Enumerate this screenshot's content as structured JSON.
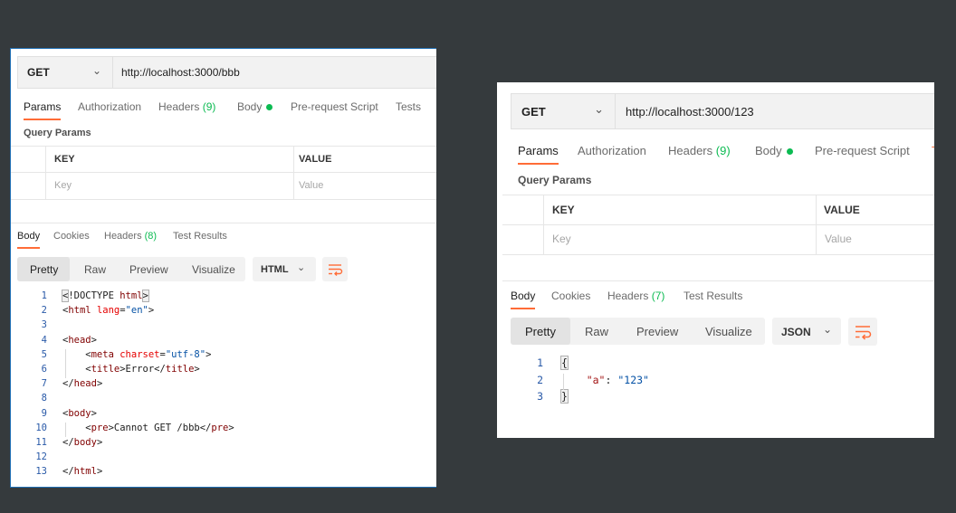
{
  "left_panel": {
    "method": "GET",
    "url": "http://localhost:3000/bbb",
    "request_tabs": [
      "Params",
      "Authorization",
      "Headers",
      "(9)",
      "Body",
      "Pre-request Script",
      "Tests"
    ],
    "query_params_label": "Query Params",
    "table": {
      "key_header": "KEY",
      "value_header": "VALUE",
      "key_placeholder": "Key",
      "value_placeholder": "Value"
    },
    "response_tabs": [
      "Body",
      "Cookies",
      "Headers",
      "(8)",
      "Test Results"
    ],
    "view_modes": [
      "Pretty",
      "Raw",
      "Preview",
      "Visualize"
    ],
    "format": "HTML",
    "code_lines": [
      {
        "n": "1",
        "parts": [
          [
            "bracket",
            "<"
          ],
          [
            "",
            "!DOCTYPE "
          ],
          [
            "tag",
            "html"
          ],
          [
            "bracket",
            ">"
          ]
        ]
      },
      {
        "n": "2",
        "parts": [
          [
            "",
            "<"
          ],
          [
            "tag",
            "html"
          ],
          [
            "attr",
            " lang"
          ],
          [
            "",
            "="
          ],
          [
            "str",
            "\"en\""
          ],
          [
            "",
            ">"
          ]
        ]
      },
      {
        "n": "3",
        "parts": []
      },
      {
        "n": "4",
        "parts": [
          [
            "",
            "<"
          ],
          [
            "tag",
            "head"
          ],
          [
            "",
            ">"
          ]
        ]
      },
      {
        "n": "5",
        "parts": [
          [
            "",
            "    <"
          ],
          [
            "tag",
            "meta"
          ],
          [
            "attr",
            " charset"
          ],
          [
            "",
            "="
          ],
          [
            "str",
            "\"utf-8\""
          ],
          [
            "",
            ">"
          ]
        ]
      },
      {
        "n": "6",
        "parts": [
          [
            "",
            "    <"
          ],
          [
            "tag",
            "title"
          ],
          [
            "",
            ">Error</"
          ],
          [
            "tag",
            "title"
          ],
          [
            "",
            ">"
          ]
        ]
      },
      {
        "n": "7",
        "parts": [
          [
            "",
            "</"
          ],
          [
            "tag",
            "head"
          ],
          [
            "",
            ">"
          ]
        ]
      },
      {
        "n": "8",
        "parts": []
      },
      {
        "n": "9",
        "parts": [
          [
            "",
            "<"
          ],
          [
            "tag",
            "body"
          ],
          [
            "",
            ">"
          ]
        ]
      },
      {
        "n": "10",
        "parts": [
          [
            "",
            "    <"
          ],
          [
            "tag",
            "pre"
          ],
          [
            "",
            ">Cannot GET /bbb</"
          ],
          [
            "tag",
            "pre"
          ],
          [
            "",
            ">"
          ]
        ]
      },
      {
        "n": "11",
        "parts": [
          [
            "",
            "</"
          ],
          [
            "tag",
            "body"
          ],
          [
            "",
            ">"
          ]
        ]
      },
      {
        "n": "12",
        "parts": []
      },
      {
        "n": "13",
        "parts": [
          [
            "",
            "</"
          ],
          [
            "tag",
            "html"
          ],
          [
            "",
            ">"
          ]
        ]
      }
    ]
  },
  "right_panel": {
    "method": "GET",
    "url": "http://localhost:3000/123",
    "request_tabs": [
      "Params",
      "Authorization",
      "Headers",
      "(9)",
      "Body",
      "Pre-request Script"
    ],
    "query_params_label": "Query Params",
    "table": {
      "key_header": "KEY",
      "value_header": "VALUE",
      "key_placeholder": "Key",
      "value_placeholder": "Value"
    },
    "response_tabs": [
      "Body",
      "Cookies",
      "Headers",
      "(7)",
      "Test Results"
    ],
    "view_modes": [
      "Pretty",
      "Raw",
      "Preview",
      "Visualize"
    ],
    "format": "JSON",
    "code_lines": [
      {
        "n": "1",
        "parts": [
          [
            "bracket",
            "{"
          ]
        ]
      },
      {
        "n": "2",
        "parts": [
          [
            "",
            "    "
          ],
          [
            "key",
            "\"a\""
          ],
          [
            "",
            ": "
          ],
          [
            "str",
            "\"123\""
          ]
        ]
      },
      {
        "n": "3",
        "parts": [
          [
            "bracket",
            "}"
          ]
        ]
      }
    ]
  },
  "colors": {
    "accent": "#ff6c37",
    "count_green": "#0cbb52",
    "background": "#353a3d"
  },
  "icons": {
    "wrap": "wrap-lines-icon",
    "chevron": "chevron-down-icon",
    "status_dot": "status-dot-icon"
  }
}
